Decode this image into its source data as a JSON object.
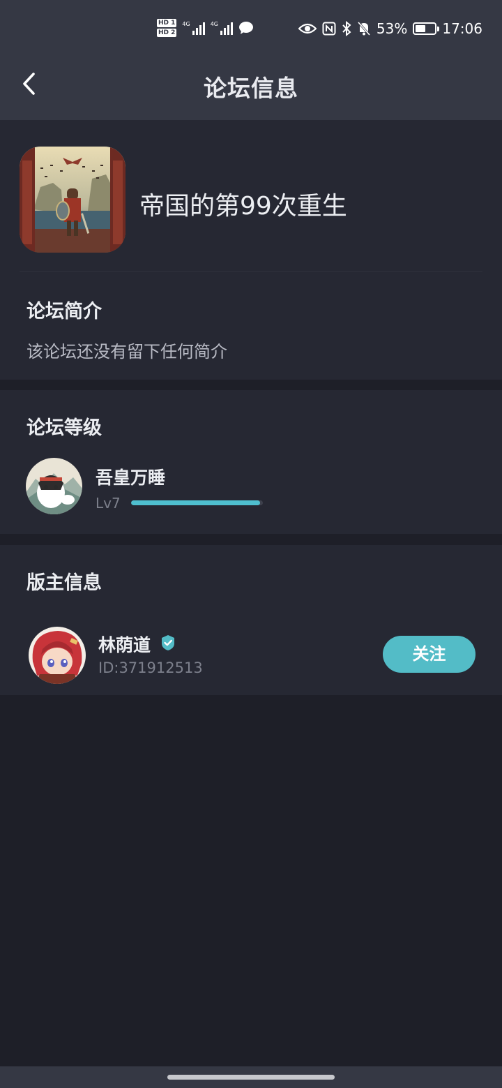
{
  "status_bar": {
    "sim1_label": "HD 1",
    "sim2_label": "HD 2",
    "network1": "4G",
    "network2": "4G",
    "battery_percent": "53%",
    "battery_level": 0.53,
    "time": "17:06"
  },
  "header": {
    "title": "论坛信息"
  },
  "forum": {
    "name": "帝国的第99次重生",
    "intro_title": "论坛简介",
    "intro_text": "该论坛还没有留下任何简介"
  },
  "level_section": {
    "title": "论坛等级",
    "user_name": "吾皇万睡",
    "level_label": "Lv7",
    "progress": 0.98
  },
  "owner_section": {
    "title": "版主信息",
    "name": "林荫道",
    "id_text": "ID:371912513",
    "follow_label": "关注"
  },
  "colors": {
    "accent": "#53bcc7",
    "background": "#1e1f28",
    "card": "#262833",
    "header": "#353844"
  }
}
